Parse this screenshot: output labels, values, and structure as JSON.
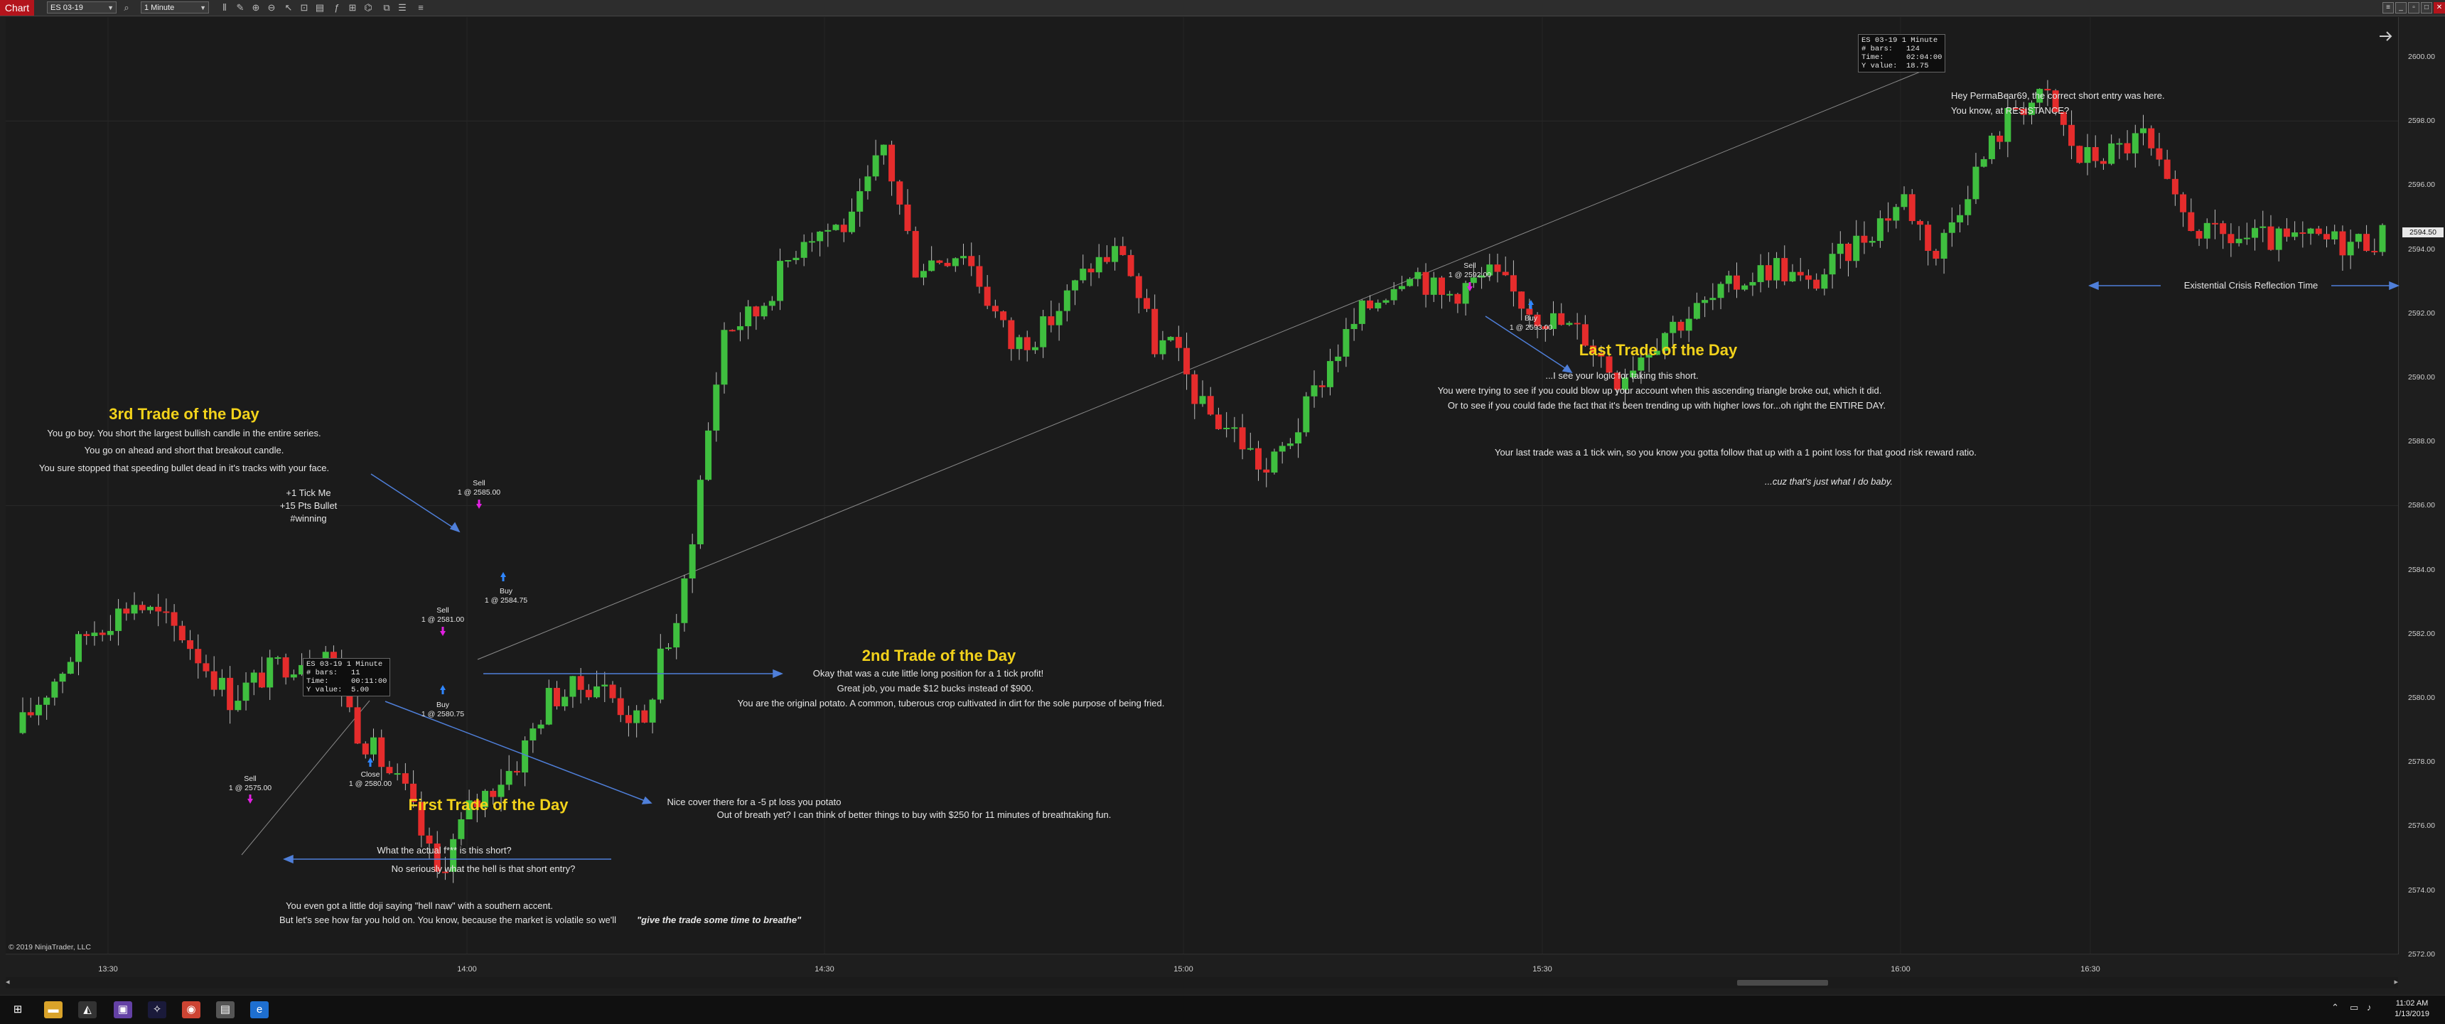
{
  "toolbar": {
    "chart_tab": "Chart",
    "instrument": "ES 03-19",
    "interval": "1 Minute"
  },
  "colors": {
    "bull": "#3fbf3f",
    "bear": "#e52c2c",
    "heading": "#f2d21b",
    "arrow": "#4f7fd9",
    "buy_marker": "#2f86ff",
    "sell_marker": "#e020e0",
    "title_tab": "#b3141c"
  },
  "y_axis": [
    "2600.00",
    "2598.00",
    "2596.00",
    "2594.00",
    "2592.00",
    "2590.00",
    "2588.00",
    "2586.00",
    "2584.00",
    "2582.00",
    "2580.00",
    "2578.00",
    "2576.00",
    "2574.00",
    "2572.00"
  ],
  "x_axis": [
    "13:30",
    "14:00",
    "14:30",
    "15:00",
    "15:30",
    "16:00",
    "16:30"
  ],
  "last_price": "2594.50",
  "copyright": "© 2019 NinjaTrader, LLC",
  "tooltips": {
    "top": "ES 03-19 1 Minute\n# bars:   124\nTime:     02:04:00\nY value:  18.75",
    "bottom": "ES 03-19 1 Minute\n# bars:   11\nTime:     00:11:00\nY value:  5.00"
  },
  "executions": {
    "sell_1": "Sell\n1 @ 2575.00",
    "close_1": "Close\n1 @ 2580.00",
    "sell_2": "Sell\n1 @ 2581.00",
    "buy_2": "Buy\n1 @ 2580.75",
    "sell_3": "Sell\n1 @ 2585.00",
    "buy_3": "Buy\n1 @ 2584.75",
    "sell_4": "Sell\n1 @ 2592.00",
    "buy_4": "Buy\n1 @ 2593.00"
  },
  "annotations": {
    "trade3": {
      "title": "3rd Trade of the Day",
      "lines": [
        "You go boy. You short the largest bullish candle in the entire series.",
        "You go on ahead and short that breakout candle.",
        "You sure stopped that speeding bullet dead in it's tracks with your face."
      ],
      "tags": [
        "+1 Tick Me",
        "+15 Pts Bullet",
        "#winning"
      ]
    },
    "trade2": {
      "title": "2nd Trade of the Day",
      "lines": [
        "Okay that was a cute little long position for a 1 tick profit!",
        "Great job, you made $12 bucks instead of $900.",
        "You are the original potato. A common, tuberous crop cultivated in dirt for the sole purpose of being fried."
      ]
    },
    "trade1": {
      "title": "First Trade of the Day",
      "cover_lines": [
        "Nice cover there for a -5 pt loss you potato",
        "Out of breath yet? I can think of better things to buy with $250 for 11 minutes of breathtaking fun."
      ],
      "short_lines": [
        "What the actual f*** is this short?",
        "No seriously what the hell is that short entry?"
      ],
      "doji_lines": [
        "You even got a little doji saying \"hell naw\" with a southern accent.",
        "But let's see how far you hold on. You know, because the market is volatile so we'll"
      ],
      "doji_quote": "\"give the trade some time to breathe\""
    },
    "last": {
      "title": "Last Trade of the Day",
      "lines": [
        "...I see your logic for taking this short.",
        "You were trying to see if you could blow up your account when this ascending triangle broke out, which it did.",
        "Or to see if you could fade the fact that it's been trending up with higher lows for...oh right the ENTIRE DAY."
      ],
      "result": "Your last trade was a 1 tick win, so you know you gotta follow that up with a 1 point loss for that good risk reward ratio.",
      "tagline": "...cuz that's just what I do baby."
    },
    "resistance": [
      "Hey PermaBear69, the correct short entry was here.",
      "You know, at RESISTANCE?"
    ],
    "crisis": "Existential Crisis Reflection Time"
  },
  "taskbar": {
    "time": "11:02 AM",
    "date": "1/13/2019"
  }
}
